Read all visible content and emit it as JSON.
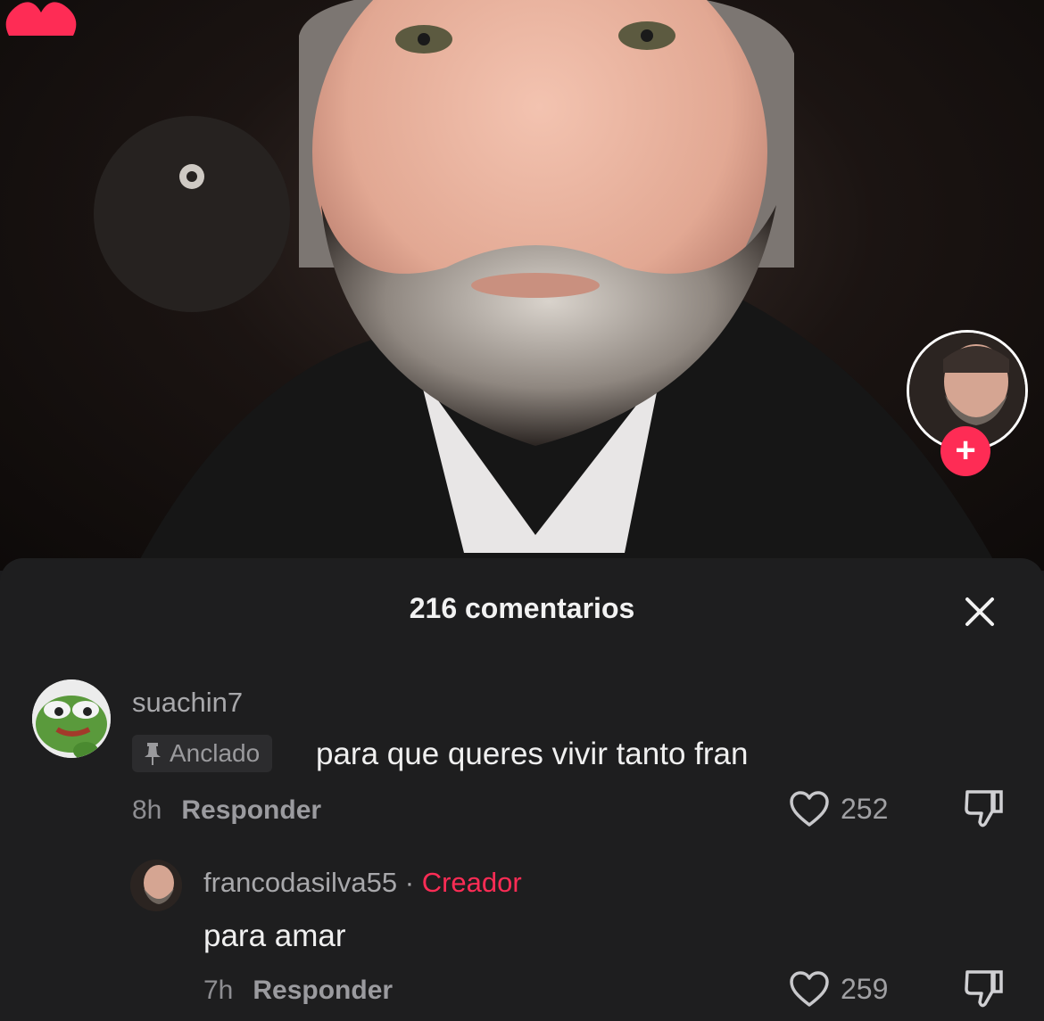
{
  "comments_panel": {
    "title": "216 comentarios",
    "comments": [
      {
        "username": "suachin7",
        "pinned_label": "Anclado",
        "text": "para que queres vivir tanto fran",
        "time": "8h",
        "reply_label": "Responder",
        "likes": "252"
      },
      {
        "username": "francodasilva55",
        "separator": "·",
        "creator_label": "Creador",
        "text": "para amar",
        "time": "7h",
        "reply_label": "Responder",
        "likes": "259"
      }
    ]
  },
  "icons": {
    "close": "close-icon",
    "follow": "plus-icon",
    "like": "heart-outline-icon",
    "dislike": "thumbs-down-icon",
    "pin": "pin-icon"
  },
  "colors": {
    "accent": "#fe2c55",
    "sheet_bg": "#1e1e1f"
  }
}
